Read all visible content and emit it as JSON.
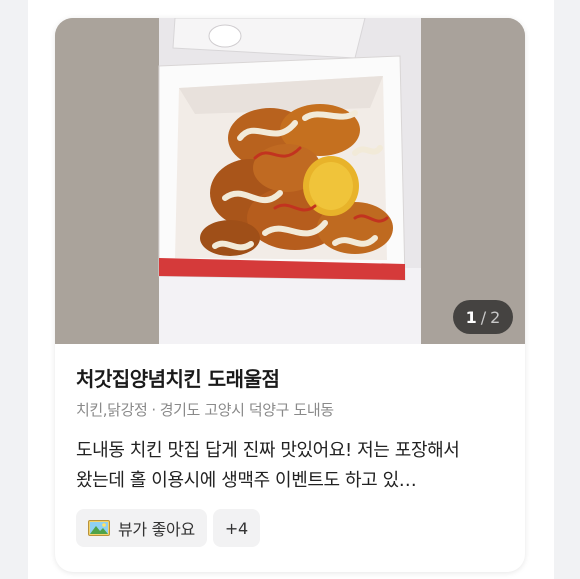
{
  "place": {
    "name": "처갓집양념치킨 도래울점",
    "categories": "치킨,닭강정",
    "location": "경기도 고양시 덕양구 도내동",
    "separator": "·"
  },
  "review": {
    "text": "도내동 치킨 맛집 답게 진짜 맛있어요! 저는 포장해서 왔는데 홀 이용시에 생맥주 이벤트도 하고 있…"
  },
  "photo_pager": {
    "current": "1",
    "separator": "/",
    "total": "2"
  },
  "tags": {
    "keyword": {
      "label": "뷰가 좋아요",
      "icon": "landscape-picture-icon"
    },
    "more_label": "+4"
  },
  "colors": {
    "background": "#f1f2f4",
    "card": "#ffffff",
    "pager_bg": "#2b2b2b",
    "tag_bg": "#f2f2f3",
    "meta_text": "#8a8a8a"
  }
}
